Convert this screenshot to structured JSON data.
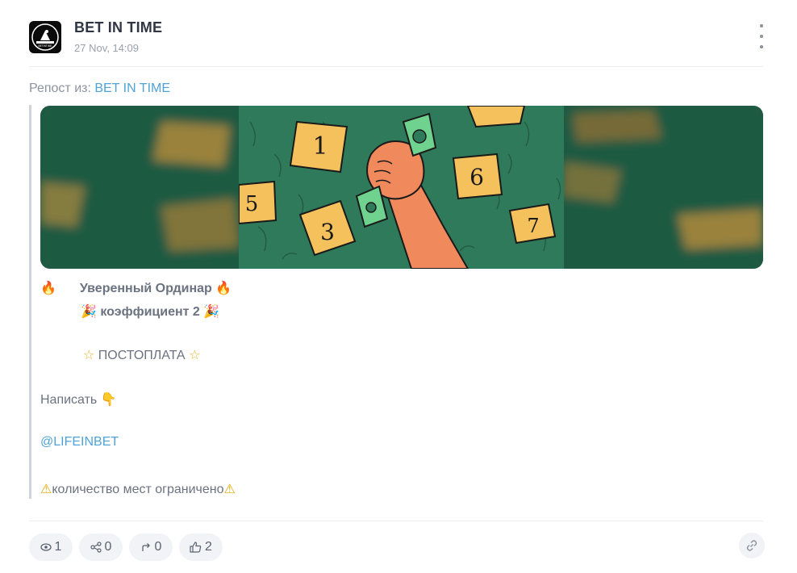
{
  "channel": {
    "name": "BET IN TIME",
    "time": "27 Nov, 14:09",
    "avatar_text": "BETINTIME"
  },
  "repost": {
    "prefix": "Репост из:",
    "source": "BET IN TIME"
  },
  "banner": {
    "notes": [
      "1",
      "5",
      "3",
      "6",
      "7"
    ]
  },
  "message": {
    "line1": "Уверенный Ординар",
    "line2": "коэффициент 2",
    "line3": "ПОСТОПЛАТА",
    "line4": "Написать",
    "mention": "@LIFEINBET",
    "line5": "количество мест ограничено"
  },
  "stats": {
    "views": "1",
    "shares": "0",
    "forwards": "0",
    "likes": "2"
  },
  "colors": {
    "accent": "#4ea3d8",
    "banner_green": "#2f7a5a",
    "note_yellow": "#f4c15d",
    "hand_orange": "#f08a5d"
  },
  "icons": [
    "avatar-logo",
    "more-vertical-icon",
    "fire-icon",
    "party-popper-icon",
    "star-icon",
    "pointing-down-icon",
    "warning-icon",
    "eye-icon",
    "share-icon",
    "forward-icon",
    "thumbs-up-icon",
    "link-icon"
  ]
}
